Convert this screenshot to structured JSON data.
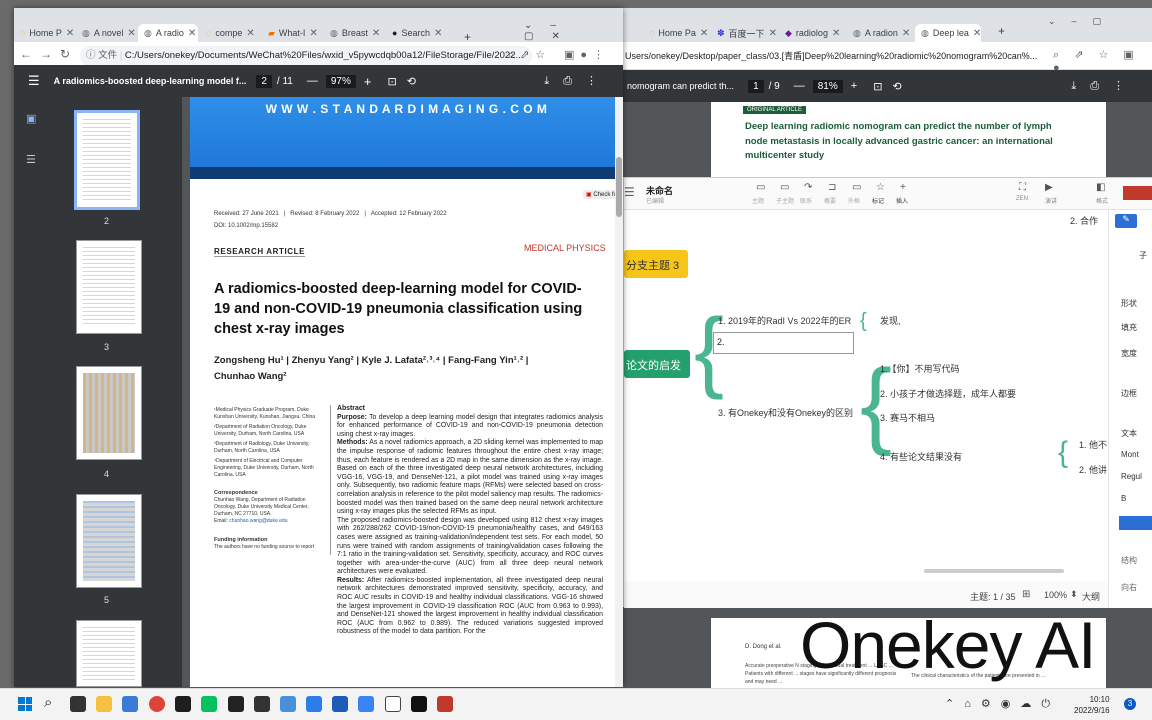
{
  "left_browser": {
    "tabs": [
      {
        "label": "Home P",
        "icon": "loader-icon",
        "color": "#f29900"
      },
      {
        "label": "A novel",
        "icon": "globe-icon",
        "color": "#5f6368"
      },
      {
        "label": "A radio",
        "icon": "globe-icon",
        "color": "#5f6368",
        "active": true
      },
      {
        "label": "compe",
        "icon": "loader-icon",
        "color": "#f29900"
      },
      {
        "label": "What-I",
        "icon": "doc-icon",
        "color": "#e8710a"
      },
      {
        "label": "Breast",
        "icon": "globe-icon",
        "color": "#5f6368"
      },
      {
        "label": "Search",
        "icon": "github-icon",
        "color": "#202124"
      }
    ],
    "address_prefix": "文件",
    "address": "C:/Users/onekey/Documents/WeChat%20Files/wxid_v5pywcdqb00a12/FileStorage/File/2022...",
    "pdf_title": "A radiomics-boosted deep-learning model f...",
    "page_current": "2",
    "page_total": "/ 11",
    "zoom": "97%",
    "thumb_labels": [
      "2",
      "3",
      "4",
      "5"
    ]
  },
  "paper": {
    "banner_text": "W W W . S T A N D A R D I M A G I N G . C O M",
    "check_updates": "Check fo",
    "received": "Received: 27 June 2021",
    "revised": "Revised: 8 February 2022",
    "accepted": "Accepted: 12 February 2022",
    "doi": "DOI: 10.1002/mp.15582",
    "article_type": "RESEARCH ARTICLE",
    "section": "MEDICAL PHYSICS",
    "title": "A radiomics-boosted deep-learning model for COVID-19 and non-COVID-19 pneumonia classification using chest x-ray images",
    "authors_line1": "Zongsheng Hu¹  |  Zhenyu Yang²  |  Kyle J. Lafata²˒³˒⁴  |  Fang-Fang Yin¹˒²  |",
    "authors_line2": "Chunhao Wang²",
    "affiliations": [
      "¹Medical Physics Graduate Program, Duke Kunshan University, Kunshan, Jiangsu, China",
      "²Department of Radiation Oncology, Duke University, Durham, North Carolina, USA",
      "³Department of Radiology, Duke University, Durham, North Carolina, USA",
      "⁴Department of Electrical and Computer Engineering, Duke University, Durham, North Carolina, USA"
    ],
    "correspondence_head": "Correspondence",
    "correspondence": "Chunhao Wang, Department of Radiation Oncology, Duke University Medical Center, Durham, NC 27710, USA.",
    "email_label": "Email:",
    "email": "chunhao.wang@duke.edu",
    "funding_head": "Funding information",
    "funding": "The authors have no funding source to report",
    "abstract_head": "Abstract",
    "purpose_head": "Purpose:",
    "purpose": "To develop a deep learning model design that integrates radiomics analysis for enhanced performance of COVID-19 and non-COVID-19 pneumonia detection using chest x-ray images.",
    "methods_head": "Methods:",
    "methods": "As a novel radiomics approach, a 2D sliding kernel was implemented to map the impulse response of radiomic features throughout the entire chest x-ray image; thus, each feature is rendered as a 2D map in the same dimension as the x-ray image. Based on each of the three investigated deep neural network architectures, including VGG-16, VGG-19, and DenseNet-121, a pilot model was trained using x-ray images only. Subsequently, two radiomic feature maps (RFMs) were selected based on cross-correlation analysis in reference to the pilot model saliency map results. The radiomics-boosted model was then trained based on the same deep neural network architecture using x-ray images plus the selected RFMs as input.",
    "methods2": "The proposed radiomics-boosted design was developed using 812 chest x-ray images with 262/288/262 COVID-19/non-COVID-19 pneumonia/healthy cases, and 649/163 cases were assigned as training-validation/independent test sets. For each model, 50 runs were trained with random assignments of training/validation cases following the 7:1 ratio in the training-validation set. Sensitivity, specificity, accuracy, and ROC curves together with area-under-the-curve (AUC) from all three deep neural network architectures were evaluated.",
    "results_head": "Results:",
    "results": "After radiomics-boosted implementation, all three investigated deep neural network architectures demonstrated improved sensitivity, specificity, accuracy, and ROC AUC results in COVID-19 and healthy individual classifications. VGG-16 showed the largest improvement in COVID-19 classification ROC (AUC from 0.963 to 0.993), and DenseNet-121 showed the largest improvement in healthy individual classification ROC (AUC from 0.962 to 0.989). The reduced variations suggested improved robustness of the model to data partition. For the"
  },
  "right_browser": {
    "tabs": [
      {
        "label": "Home Pa",
        "icon": "loader-icon",
        "color": "#f29900"
      },
      {
        "label": "百度一下",
        "icon": "paw-icon",
        "color": "#2932e1"
      },
      {
        "label": "radiolog",
        "icon": "shield-icon",
        "color": "#6a1b9a"
      },
      {
        "label": "A radion",
        "icon": "globe-icon",
        "color": "#5f6368"
      },
      {
        "label": "Deep lea",
        "icon": "globe-icon",
        "color": "#5f6368",
        "active": true
      }
    ],
    "address": "Users/onekey/Desktop/paper_class/03.[青盾]Deep%20learning%20radiomic%20nomogram%20can%...",
    "pdf_title": "nomogram can predict th...",
    "page_current": "1",
    "page_total": "/ 9",
    "zoom": "81%",
    "article_tag": "ORIGINAL ARTICLE",
    "article_title": "Deep learning radiomic nomogram can predict the number of lymph node metastasis in locally advanced gastric cancer: an international multicenter study",
    "page2_author": "D. Dong et al.",
    "page2_text": "Accurate preoperative N staging ... individual treatment ... LAGC ... Patients with different ... stages have significantly different prognosis and may need ...",
    "page2_text_right": "The clinical characteristics of the patients are presented in ..."
  },
  "mindmap": {
    "doc_title": "未命名",
    "doc_status": "已编辑",
    "tools": [
      "主题",
      "子主题",
      "联系",
      "概要",
      "外框",
      "标记",
      "插入"
    ],
    "tools_right": [
      "ZEN",
      "演讲",
      "格式"
    ],
    "node_branch3": "分支主题 3",
    "node_main": "论文的启发",
    "items": [
      "1. 2019年的RadI Vs 2022年的ER",
      "2.",
      "3. 有Onekey和没有Onekey的区别"
    ],
    "sub_found": "发现,",
    "sub_items": [
      "1.【你】不用写代码",
      "2. 小孩子才做选择题，成年人都要",
      "3. 赛马不相马",
      "4. 有些论文结果没有"
    ],
    "far_items": [
      "1. 他不",
      "2. 他讲"
    ],
    "top_right_fragment": "2. 合作",
    "panel_labels": [
      "子",
      "形状",
      "填充",
      "宽度",
      "边框",
      "文本",
      "Mont",
      "Regul",
      "B",
      "结构",
      "向右"
    ],
    "status_topics": "主题: 1 / 35",
    "status_zoom": "100%",
    "status_size": "大纲"
  },
  "watermark": "Onekey AI",
  "taskbar": {
    "time": "10:10",
    "date": "2022/9/16",
    "notif_count": "3"
  }
}
